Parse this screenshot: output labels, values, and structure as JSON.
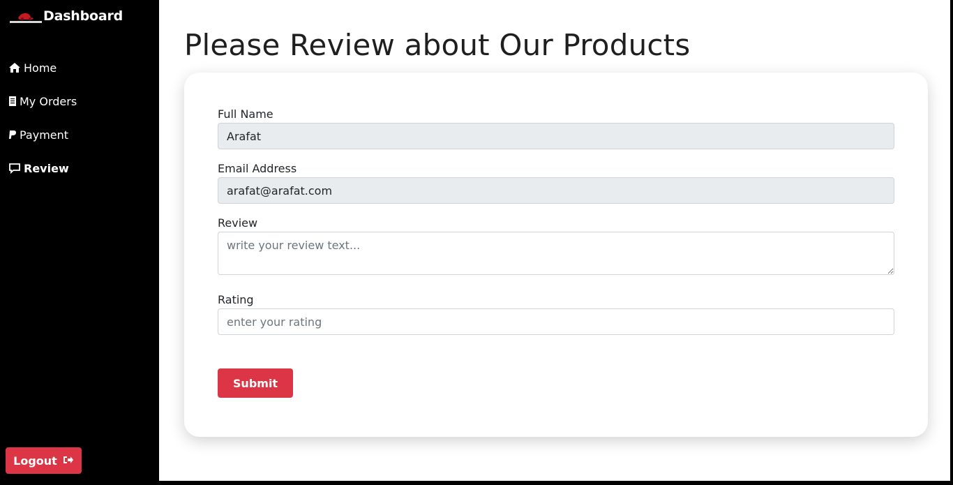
{
  "sidebar": {
    "brand_title": "Dashboard",
    "items": [
      {
        "label": "Home",
        "icon": "home-icon"
      },
      {
        "label": "My Orders",
        "icon": "receipt-icon"
      },
      {
        "label": "Payment",
        "icon": "paypal-icon"
      },
      {
        "label": "Review",
        "icon": "comment-icon",
        "active": true
      }
    ],
    "logout_label": "Logout"
  },
  "main": {
    "title": "Please Review about Our Products",
    "form": {
      "name_label": "Full Name",
      "name_value": "Arafat",
      "email_label": "Email Address",
      "email_value": "arafat@arafat.com",
      "review_label": "Review",
      "review_placeholder": "write your review text...",
      "rating_label": "Rating",
      "rating_placeholder": "enter your rating",
      "submit_label": "Submit"
    }
  },
  "colors": {
    "accent": "#dc3545",
    "sidebar_bg": "#000000",
    "readonly_bg": "#e9ecef"
  }
}
